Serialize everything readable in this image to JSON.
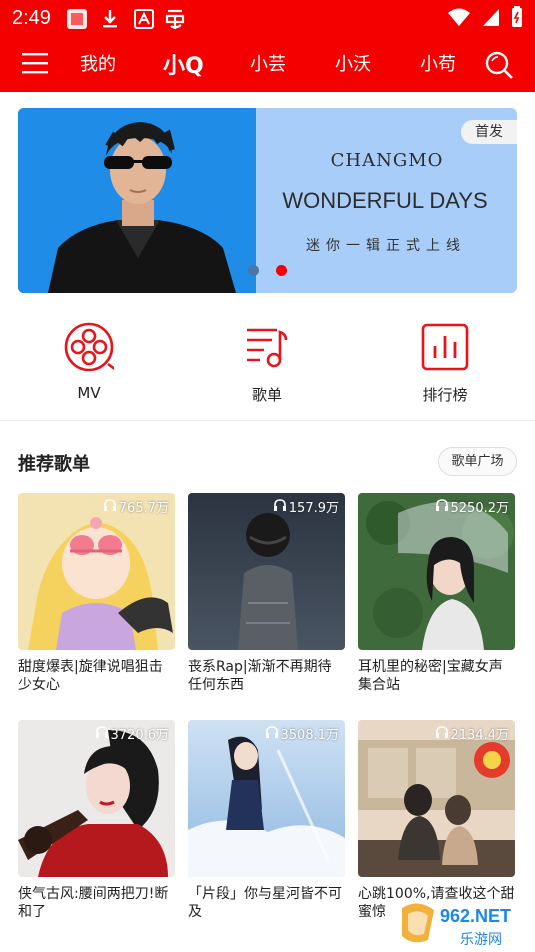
{
  "status_bar": {
    "time": "2:49",
    "icons": [
      "notification-square-icon",
      "download-icon",
      "a-badge-icon",
      "bug-app-icon"
    ],
    "right_icons": [
      "wifi-icon",
      "signal-icon",
      "battery-icon"
    ]
  },
  "top_nav": {
    "tabs": [
      "我的",
      "小Q",
      "小芸",
      "小沃",
      "小苟"
    ],
    "active_tab": "小Q"
  },
  "banner": {
    "badge": "首发",
    "artist": "CHANGMO",
    "album": "WONDERFUL DAYS",
    "subtitle": "迷你一辑正式上线",
    "active_dot": 1
  },
  "quick_links": [
    {
      "label": "MV",
      "icon": "film-reel-icon"
    },
    {
      "label": "歌单",
      "icon": "playlist-icon"
    },
    {
      "label": "排行榜",
      "icon": "chart-icon"
    }
  ],
  "recommend": {
    "title": "推荐歌单",
    "more_button": "歌单广场",
    "playlists": [
      {
        "plays": "765.7万",
        "title": "甜度爆表|旋律说唱狙击少女心"
      },
      {
        "plays": "157.9万",
        "title": "丧系Rap|渐渐不再期待任何东西"
      },
      {
        "plays": "5250.2万",
        "title": "耳机里的秘密|宝藏女声集合站"
      },
      {
        "plays": "3720.6万",
        "title": "侠气古风:腰间两把刀!断和了"
      },
      {
        "plays": "3508.1万",
        "title": "「片段」你与星河皆不可及"
      },
      {
        "plays": "2134.4万",
        "title": "心跳100%,请查收这个甜蜜惊"
      }
    ]
  },
  "watermark": {
    "text": "962.NET",
    "subtext": "乐游网"
  },
  "colors": {
    "brand": "#f40000",
    "icon_red": "#e8141b"
  }
}
